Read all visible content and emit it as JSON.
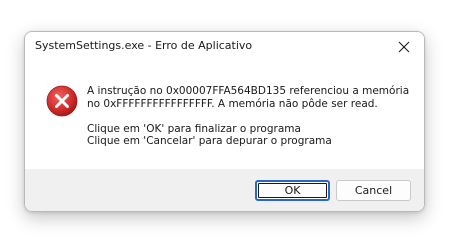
{
  "window": {
    "title": "SystemSettings.exe - Erro de Aplicativo"
  },
  "icons": {
    "close": "close-icon",
    "error": "error-icon"
  },
  "message": {
    "line1": "A instrução no 0x00007FFA564BD135 referenciou a memória",
    "line2": "no 0xFFFFFFFFFFFFFFFF. A memória não pôde ser read.",
    "line3": "Clique em 'OK' para finalizar o programa",
    "line4": "Clique em 'Cancelar' para depurar o programa"
  },
  "buttons": {
    "ok": "OK",
    "cancel": "Cancel"
  },
  "colors": {
    "error_red": "#d32f2f",
    "accent_blue": "#2a66c8",
    "footer_bg": "#f0f0f0"
  }
}
